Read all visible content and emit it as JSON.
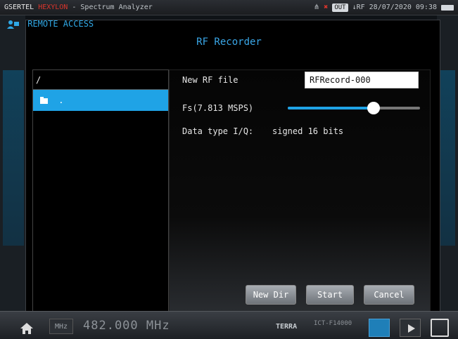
{
  "statusbar": {
    "brand1": "GSERTEL",
    "brand2": "HEXYLON",
    "app": "- Spectrum Analyzer",
    "out_badge": "OUT",
    "rf_date": "↓RF 28/07/2020 09:38"
  },
  "remote_access": {
    "label": "REMOTE ACCESS"
  },
  "dialog": {
    "title": "RF Recorder",
    "path": "/",
    "dir_entry": ".",
    "new_file_label": "New RF file",
    "new_file_value": "RFRecord-000",
    "fs_label": "Fs(7.813 MSPS)",
    "fs_slider_fraction": 0.65,
    "data_type_label": "Data type I/Q:",
    "data_type_value": "signed 16 bits",
    "buttons": {
      "new_dir": "New Dir",
      "start": "Start",
      "cancel": "Cancel"
    }
  },
  "bottombar": {
    "unit": "MHz",
    "frequency": "482.000 MHz",
    "brand": "TERRA",
    "device": "ICT-F14000"
  },
  "colors": {
    "accent": "#1fa3e6",
    "title": "#3aa7e8"
  }
}
